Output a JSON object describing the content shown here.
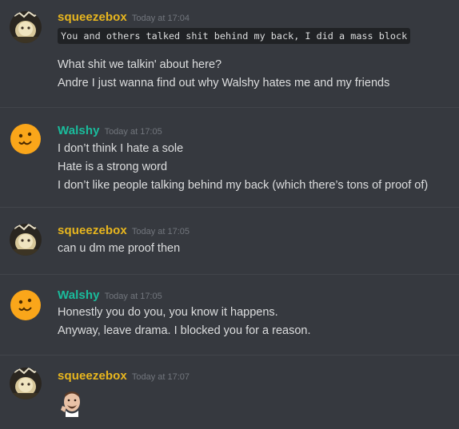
{
  "colors": {
    "background": "#36393f",
    "squeezebox_name": "#e8b61e",
    "walshy_name": "#1abc9c",
    "message_text": "#dcddde",
    "timestamp": "#72767d"
  },
  "messages": [
    {
      "author": "squeezebox",
      "timestamp": "Today at 17:04",
      "avatar_icon": "squeezebox-avatar-icon",
      "lines": [
        "You and others talked shit behind my back, I did a mass block",
        "What shit we talkin' about here?",
        "Andre I just wanna find out why Walshy hates me and my friends"
      ]
    },
    {
      "author": "Walshy",
      "timestamp": "Today at 17:05",
      "avatar_icon": "orange-blob-avatar-icon",
      "lines": [
        "I don’t think I hate a sole",
        "Hate is a strong word",
        "I don’t like people talking behind my back (which there’s tons of proof of)"
      ]
    },
    {
      "author": "squeezebox",
      "timestamp": "Today at 17:05",
      "avatar_icon": "squeezebox-avatar-icon",
      "lines": [
        "can u dm me proof then"
      ]
    },
    {
      "author": "Walshy",
      "timestamp": "Today at 17:05",
      "avatar_icon": "orange-blob-avatar-icon",
      "lines": [
        "Honestly you do you, you know it happens.",
        "Anyway, leave drama. I blocked you for a reason."
      ]
    },
    {
      "author": "squeezebox",
      "timestamp": "Today at 17:07",
      "avatar_icon": "squeezebox-avatar-icon",
      "emoji": "face-emoji-icon"
    }
  ]
}
